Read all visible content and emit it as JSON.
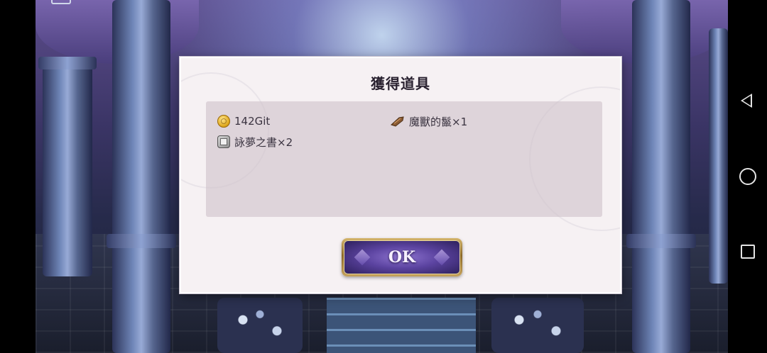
{
  "dialog": {
    "title": "獲得道具",
    "items": [
      {
        "icon": "coin-icon",
        "label": "142Git"
      },
      {
        "icon": "hair-icon",
        "label": "魔獸的鬣×1"
      },
      {
        "icon": "book-icon",
        "label": "詠夢之書×2"
      }
    ],
    "ok_label": "OK"
  },
  "nav_bar": {
    "buttons": [
      "back-icon",
      "home-icon",
      "recents-icon"
    ]
  },
  "colors": {
    "dialog_bg": "#f6f1f3",
    "panel_bg": "#cdbfc8",
    "button_gold": "#c6a25a",
    "button_purple": "#5b43a0"
  }
}
